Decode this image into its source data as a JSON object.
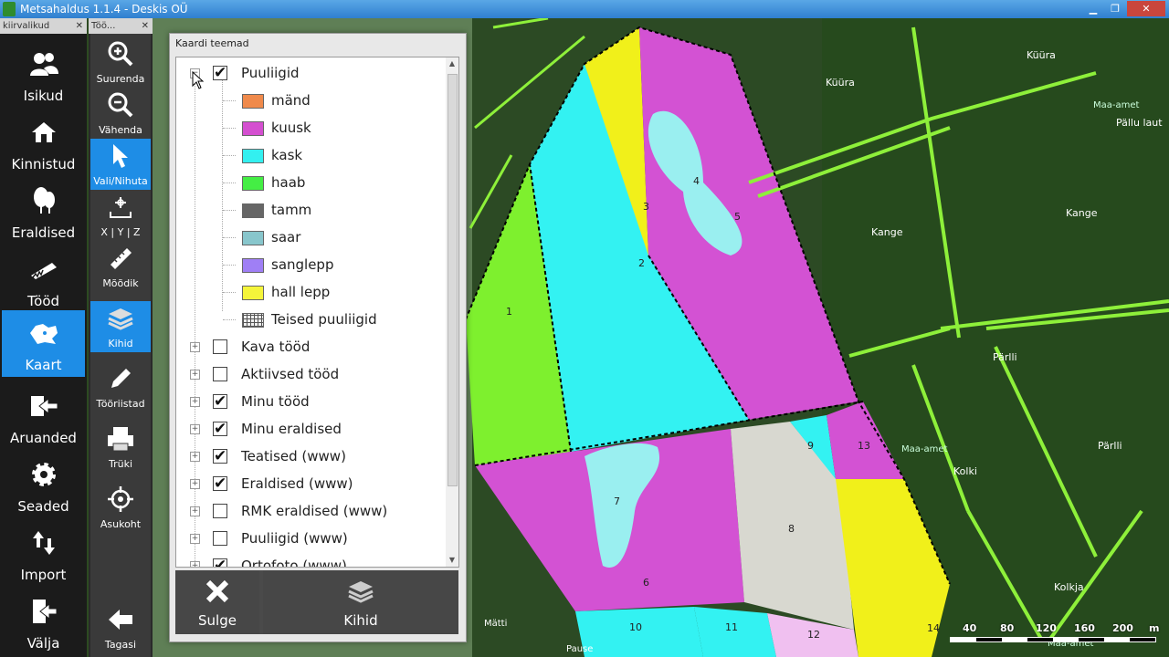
{
  "window": {
    "title": "Metsahaldus 1.1.4 - Deskis OÜ"
  },
  "left_panel": {
    "tab_label": "kiirvalikud",
    "items": [
      {
        "label": "Isikud",
        "icon": "people-icon"
      },
      {
        "label": "Kinnistud",
        "icon": "house-icon"
      },
      {
        "label": "Eraldised",
        "icon": "trees-icon"
      },
      {
        "label": "Tööd",
        "icon": "saw-icon"
      },
      {
        "label": "Kaart",
        "icon": "map-icon",
        "active": true
      },
      {
        "label": "Aruanded",
        "icon": "report-arrow-icon"
      },
      {
        "label": "Seaded",
        "icon": "gear-icon"
      },
      {
        "label": "Import",
        "icon": "import-arrows-icon"
      },
      {
        "label": "Välja",
        "icon": "exit-door-icon"
      }
    ]
  },
  "tool_panel": {
    "tab_label": "Töö...",
    "items": [
      {
        "label": "Suurenda",
        "icon": "zoom-in-icon"
      },
      {
        "label": "Vähenda",
        "icon": "zoom-out-icon"
      },
      {
        "label": "Vali/Nihuta",
        "icon": "pointer-icon",
        "active": true
      },
      {
        "label": "X | Y | Z",
        "icon": "xyz-icon"
      },
      {
        "label": "Mõõdik",
        "icon": "ruler-icon"
      },
      {
        "label": "Kihid",
        "icon": "layers-icon",
        "active": true
      },
      {
        "label": "Tööriistad",
        "icon": "pencil-icon"
      },
      {
        "label": "Trüki",
        "icon": "printer-pdf-icon"
      },
      {
        "label": "Asukoht",
        "icon": "target-icon"
      },
      {
        "label": "Tagasi",
        "icon": "back-arrow-icon"
      }
    ]
  },
  "dialog": {
    "title": "Kaardi teemad",
    "tree": {
      "root": {
        "label": "Puuliigid",
        "checked": true,
        "expanded": true
      },
      "children": [
        {
          "label": "mänd",
          "color": "#f08a4b"
        },
        {
          "label": "kuusk",
          "color": "#d44fd0"
        },
        {
          "label": "kask",
          "color": "#33f0f0"
        },
        {
          "label": "haab",
          "color": "#44ee44"
        },
        {
          "label": "tamm",
          "color": "#666666"
        },
        {
          "label": "saar",
          "color": "#88c6cc"
        },
        {
          "label": "sanglepp",
          "color": "#9f7ff5"
        },
        {
          "label": "hall lepp",
          "color": "#f5f53a"
        },
        {
          "label": "Teised puuliigid",
          "color": "pattern"
        }
      ],
      "layers": [
        {
          "label": "Kava tööd",
          "checked": false
        },
        {
          "label": "Aktiivsed tööd",
          "checked": false
        },
        {
          "label": "Minu tööd",
          "checked": true
        },
        {
          "label": "Minu eraldised",
          "checked": true
        },
        {
          "label": "Teatised (www)",
          "checked": true
        },
        {
          "label": "Eraldised (www)",
          "checked": true
        },
        {
          "label": "RMK eraldised (www)",
          "checked": false
        },
        {
          "label": "Puuliigid (www)",
          "checked": false
        },
        {
          "label": "Ortofoto (www)",
          "checked": true
        }
      ]
    },
    "buttons": {
      "close_label": "Sulge",
      "layers_label": "Kihid"
    }
  },
  "map": {
    "place_names": [
      "Küüra",
      "Küüra",
      "Kange",
      "Kange",
      "Pärlli",
      "Pärlli",
      "Kolki",
      "Kolkja",
      "Pällu laut",
      "Maa-amet",
      "Maa-amet",
      "Maa-amet",
      "Mätti",
      "Pause"
    ],
    "parcel_numbers": [
      "1",
      "2",
      "3",
      "4",
      "5",
      "6",
      "7",
      "8",
      "9",
      "10",
      "11",
      "12",
      "13",
      "14"
    ],
    "scale_ticks": [
      "40",
      "80",
      "120",
      "160",
      "200",
      "m"
    ]
  }
}
